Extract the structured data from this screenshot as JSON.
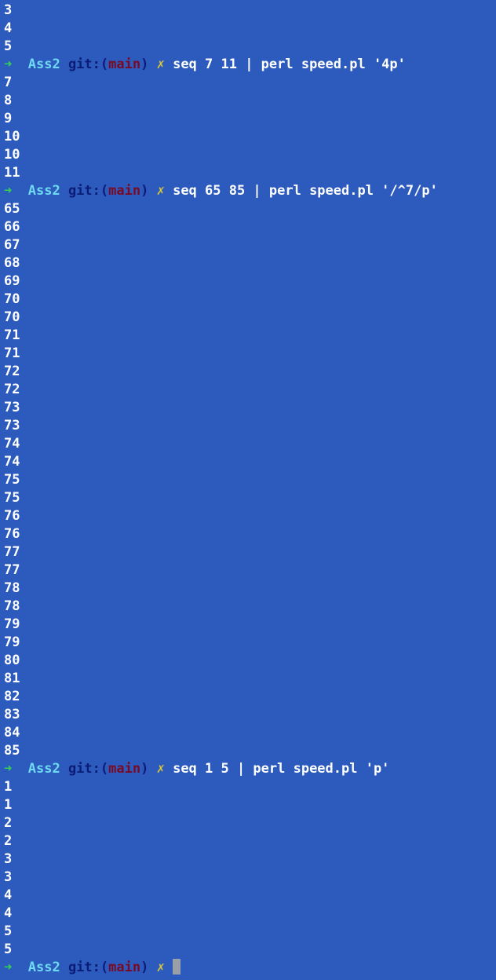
{
  "colors": {
    "background": "#2c5bbd",
    "output_text": "#ffffff",
    "prompt_arrow": "#34d058",
    "prompt_dir": "#6fd9f2",
    "prompt_git": "#0b1c78",
    "prompt_branch": "#7a0a24",
    "prompt_dirty": "#d8c63a",
    "cursor": "#9aa0a8"
  },
  "prompt": {
    "arrow": "➜",
    "dir": "Ass2",
    "git_open": "git:(",
    "branch": "main",
    "git_close": ")",
    "dirty_mark": "✗"
  },
  "blocks": [
    {
      "type": "output",
      "lines": [
        "3",
        "4",
        "5"
      ]
    },
    {
      "type": "prompt",
      "command": "seq 7 11 | perl speed.pl '4p'"
    },
    {
      "type": "output",
      "lines": [
        "7",
        "8",
        "9",
        "10",
        "10",
        "11"
      ]
    },
    {
      "type": "prompt",
      "command": "seq 65 85 | perl speed.pl '/^7/p'"
    },
    {
      "type": "output",
      "lines": [
        "65",
        "66",
        "67",
        "68",
        "69",
        "70",
        "70",
        "71",
        "71",
        "72",
        "72",
        "73",
        "73",
        "74",
        "74",
        "75",
        "75",
        "76",
        "76",
        "77",
        "77",
        "78",
        "78",
        "79",
        "79",
        "80",
        "81",
        "82",
        "83",
        "84",
        "85"
      ]
    },
    {
      "type": "prompt",
      "command": "seq 1 5 | perl speed.pl 'p'"
    },
    {
      "type": "output",
      "lines": [
        "1",
        "1",
        "2",
        "2",
        "3",
        "3",
        "4",
        "4",
        "5",
        "5"
      ]
    },
    {
      "type": "prompt",
      "command": "",
      "active": true
    }
  ]
}
